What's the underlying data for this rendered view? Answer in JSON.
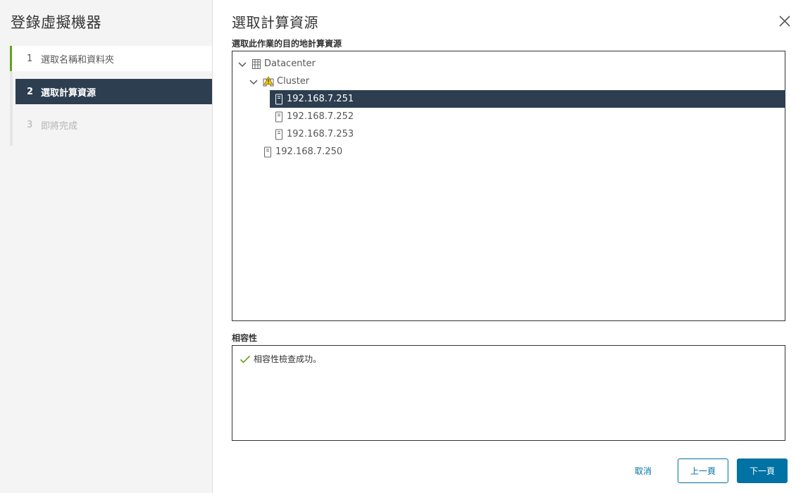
{
  "wizard": {
    "title": "登錄虛擬機器",
    "steps": [
      {
        "num": "1",
        "label": "選取名稱和資料夾",
        "state": "done"
      },
      {
        "num": "2",
        "label": "選取計算資源",
        "state": "active"
      },
      {
        "num": "3",
        "label": "即將完成",
        "state": "pending"
      }
    ]
  },
  "main": {
    "title": "選取計算資源",
    "tree_label": "選取此作業的目的地計算資源",
    "tree": {
      "datacenter": "Datacenter",
      "cluster": "Cluster",
      "hosts": [
        "192.168.7.251",
        "192.168.7.252",
        "192.168.7.253"
      ],
      "standalone_host": "192.168.7.250",
      "selected": "192.168.7.251"
    },
    "compat_label": "相容性",
    "compat_message": "相容性檢查成功。"
  },
  "footer": {
    "cancel": "取消",
    "back": "上一頁",
    "next": "下一頁"
  },
  "colors": {
    "accent": "#0072a3",
    "selected_bg": "#2c3e50",
    "done_bar": "#62a420",
    "success_check": "#62a420",
    "warning": "#f5c400"
  },
  "icons": [
    "close-icon",
    "chevron-down-icon",
    "datacenter-icon",
    "cluster-warning-icon",
    "host-icon",
    "checkmark-icon"
  ]
}
